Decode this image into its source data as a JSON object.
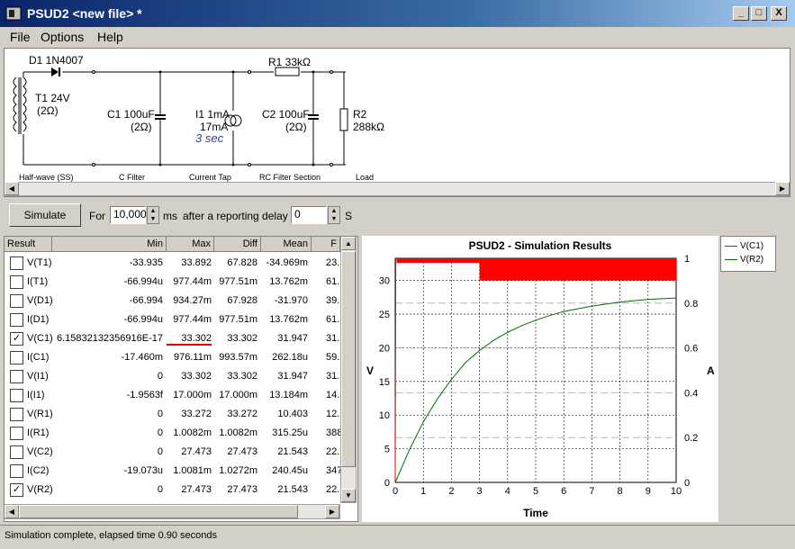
{
  "window": {
    "title": "PSUD2  <new file> *",
    "min": "_",
    "max": "□",
    "close": "X"
  },
  "menu": [
    "File",
    "Options",
    "Help"
  ],
  "schematic": {
    "diode": "D1 1N4007",
    "transformer_name": "T1 24V",
    "transformer_res": "(2Ω)",
    "c1_name": "C1 100uF",
    "c1_res": "(2Ω)",
    "i1_name": "I1 1mA",
    "i1_val": "17mA",
    "i1_time": "3 sec",
    "r1": "R1 33kΩ",
    "c2_name": "C2 100uF",
    "c2_res": "(2Ω)",
    "r2_name": "R2",
    "r2_val": "288kΩ",
    "captions": [
      "Half-wave (SS)",
      "C Filter",
      "Current Tap",
      "RC Filter Section",
      "Load"
    ]
  },
  "controls": {
    "simulate": "Simulate",
    "for_label": "For",
    "duration": "10,000",
    "ms_label": "ms",
    "delay_label": "after a reporting delay of",
    "delay": "0",
    "s_label": "S"
  },
  "table": {
    "columns": [
      "Result",
      "Min",
      "Max",
      "Diff",
      "Mean",
      "F"
    ],
    "rows": [
      {
        "name": "V(T1)",
        "checked": false,
        "min": "-33.935",
        "max": "33.892",
        "diff": "67.828",
        "mean": "-34.969m",
        "f": "23."
      },
      {
        "name": "I(T1)",
        "checked": false,
        "min": "-66.994u",
        "max": "977.44m",
        "diff": "977.51m",
        "mean": "13.762m",
        "f": "61.1"
      },
      {
        "name": "V(D1)",
        "checked": false,
        "min": "-66.994",
        "max": "934.27m",
        "diff": "67.928",
        "mean": "-31.970",
        "f": "39."
      },
      {
        "name": "I(D1)",
        "checked": false,
        "min": "-66.994u",
        "max": "977.44m",
        "diff": "977.51m",
        "mean": "13.762m",
        "f": "61.1"
      },
      {
        "name": "V(C1)",
        "checked": true,
        "min": "6.15832132356916E-17",
        "max": "33.302",
        "diff": "33.302",
        "mean": "31.947",
        "f": "31."
      },
      {
        "name": "I(C1)",
        "checked": false,
        "min": "-17.460m",
        "max": "976.11m",
        "diff": "993.57m",
        "mean": "262.18u",
        "f": "59.2"
      },
      {
        "name": "V(I1)",
        "checked": false,
        "min": "0",
        "max": "33.302",
        "diff": "33.302",
        "mean": "31.947",
        "f": "31."
      },
      {
        "name": "I(I1)",
        "checked": false,
        "min": "-1.9563f",
        "max": "17.000m",
        "diff": "17.000m",
        "mean": "13.184m",
        "f": "14.8"
      },
      {
        "name": "V(R1)",
        "checked": false,
        "min": "0",
        "max": "33.272",
        "diff": "33.272",
        "mean": "10.403",
        "f": "12."
      },
      {
        "name": "I(R1)",
        "checked": false,
        "min": "0",
        "max": "1.0082m",
        "diff": "1.0082m",
        "mean": "315.25u",
        "f": "388."
      },
      {
        "name": "V(C2)",
        "checked": false,
        "min": "0",
        "max": "27.473",
        "diff": "27.473",
        "mean": "21.543",
        "f": "22."
      },
      {
        "name": "I(C2)",
        "checked": false,
        "min": "-19.073u",
        "max": "1.0081m",
        "diff": "1.0272m",
        "mean": "240.45u",
        "f": "347."
      },
      {
        "name": "V(R2)",
        "checked": true,
        "min": "0",
        "max": "27.473",
        "diff": "27.473",
        "mean": "21.543",
        "f": "22."
      }
    ]
  },
  "chart_data": {
    "type": "line",
    "title": "PSUD2 - Simulation Results",
    "xlabel": "Time",
    "ylabel": "V",
    "y2label": "A",
    "xlim": [
      0,
      10
    ],
    "ylim": [
      0,
      33.3
    ],
    "y2lim": [
      0,
      1
    ],
    "xticks": [
      0,
      1,
      2,
      3,
      4,
      5,
      6,
      7,
      8,
      9,
      10
    ],
    "yticks": [
      0,
      5,
      10,
      15,
      20,
      25,
      30
    ],
    "y2ticks": [
      "0",
      "0.2",
      "0.4",
      "0.6",
      "0.8",
      "1"
    ],
    "grid": true,
    "legend_position": "outside-top-right",
    "series": [
      {
        "name": "V(C1)",
        "color": "#ff0000",
        "x": [
          0,
          0.02,
          0.05,
          10
        ],
        "y": [
          0,
          33.3,
          33.2,
          33.2
        ],
        "ripple_band": {
          "x_start": 3.0,
          "x_end": 10,
          "low": 30.0,
          "high": 33.3
        }
      },
      {
        "name": "V(R2)",
        "color": "#007000",
        "x": [
          0,
          0.5,
          1,
          1.5,
          2,
          2.5,
          3,
          3.5,
          4,
          4.5,
          5,
          5.5,
          6,
          6.5,
          7,
          7.5,
          8,
          8.5,
          9,
          9.5,
          10
        ],
        "y": [
          0,
          4.8,
          9.0,
          12.4,
          15.3,
          17.8,
          19.6,
          21.1,
          22.3,
          23.3,
          24.1,
          24.8,
          25.4,
          25.8,
          26.2,
          26.5,
          26.8,
          27.0,
          27.2,
          27.3,
          27.4
        ]
      }
    ]
  },
  "status": "Simulation complete, elapsed time 0.90 seconds"
}
